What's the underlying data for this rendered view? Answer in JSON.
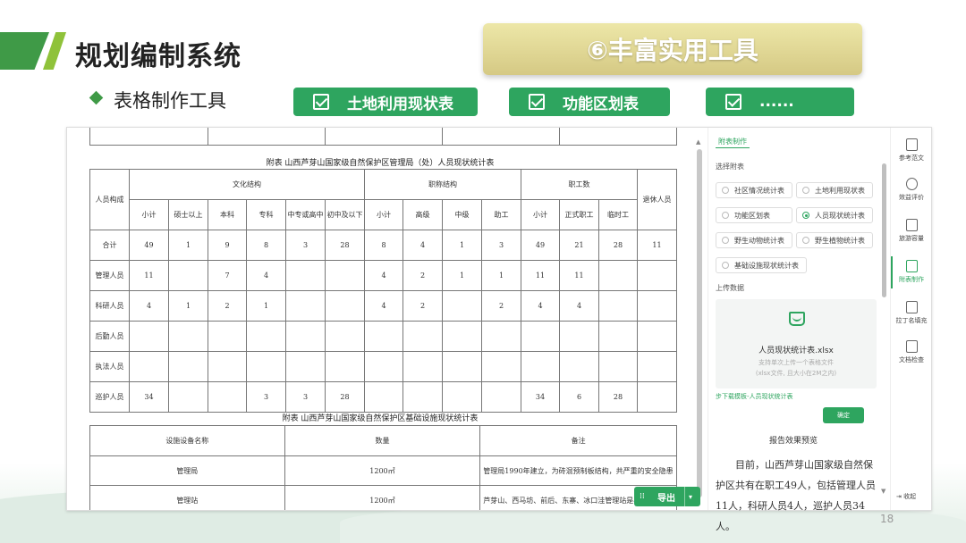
{
  "header": {
    "title": "规划编制系统",
    "feature_badge": "⑥丰富实用工具",
    "subtitle": "表格制作工具"
  },
  "feature_buttons": [
    "土地利用现状表",
    "功能区划表",
    "......"
  ],
  "doc": {
    "table1_title": "附表  山西芦芽山国家级自然保护区管理局（处）人员现状统计表",
    "t1": {
      "col_people": "人员构成",
      "grp_culture": "文化结构",
      "grp_title": "职称结构",
      "grp_staff": "职工数",
      "col_retired": "退休人员",
      "sub_culture": [
        "小计",
        "硕士以上",
        "本科",
        "专科",
        "中专或高中",
        "初中及以下"
      ],
      "sub_title": [
        "小计",
        "高级",
        "中级",
        "助工"
      ],
      "sub_staff": [
        "小计",
        "正式职工",
        "临时工"
      ],
      "rows": [
        {
          "name": "合计",
          "cells": [
            "49",
            "1",
            "9",
            "8",
            "3",
            "28",
            "8",
            "4",
            "1",
            "3",
            "49",
            "21",
            "28",
            "11"
          ]
        },
        {
          "name": "管理人员",
          "cells": [
            "11",
            "",
            "7",
            "4",
            "",
            "",
            "4",
            "2",
            "1",
            "1",
            "11",
            "11",
            "",
            ""
          ]
        },
        {
          "name": "科研人员",
          "cells": [
            "4",
            "1",
            "2",
            "1",
            "",
            "",
            "4",
            "2",
            "",
            "2",
            "4",
            "4",
            "",
            ""
          ]
        },
        {
          "name": "后勤人员",
          "cells": [
            "",
            "",
            "",
            "",
            "",
            "",
            "",
            "",
            "",
            "",
            "",
            "",
            "",
            ""
          ]
        },
        {
          "name": "执法人员",
          "cells": [
            "",
            "",
            "",
            "",
            "",
            "",
            "",
            "",
            "",
            "",
            "",
            "",
            "",
            ""
          ]
        },
        {
          "name": "巡护人员",
          "cells": [
            "34",
            "",
            "",
            "3",
            "3",
            "28",
            "",
            "",
            "",
            "",
            "34",
            "6",
            "28",
            ""
          ]
        }
      ]
    },
    "table2_title": "附表  山西芦芽山国家级自然保护区基础设施现状统计表",
    "t2": {
      "headers": [
        "设施设备名称",
        "数量",
        "备注"
      ],
      "rows": [
        {
          "name": "管理局",
          "qty": "1200㎡",
          "note": "管理局1990年建立，为砖混预制板结构，共严重的安全隐患"
        },
        {
          "name": "管理站",
          "qty": "1200㎡",
          "note": "芦芽山、西马坊、前后、东寨、冰口洼管理站是早建"
        }
      ]
    },
    "export_label": "导出"
  },
  "panel": {
    "tab": "附表制作",
    "select_label": "选择附表",
    "options": [
      "社区情况统计表",
      "土地利用现状表",
      "功能区划表",
      "人员现状统计表",
      "野生动物统计表",
      "野生植物统计表",
      "基础设施现状统计表"
    ],
    "selected": "人员现状统计表",
    "upload_label": "上传数据",
    "file_name": "人员现状统计表.xlsx",
    "hint1": "支持单次上传一个表格文件",
    "hint2": "(xlsx文件, 且大小在2M之内)",
    "download_link": "步下载模板-人员现状统计表",
    "confirm": "确定",
    "preview_title": "报告效果预览",
    "preview_text": "目前，山西芦芽山国家级自然保护区共有在职工49人，包括管理人员11人，科研人员4人，巡护人员34人。"
  },
  "sidebar": {
    "items": [
      "参考范文",
      "效益评价",
      "旅游容量",
      "附表制作",
      "拉丁名填充",
      "文档检查"
    ],
    "collapse": "收起",
    "active": "附表制作"
  },
  "page_number": "18",
  "colors": {
    "green": "#2ea55f",
    "title_green": "#3f9a47",
    "lime": "#8fc23a",
    "gold": "#d5c984"
  }
}
